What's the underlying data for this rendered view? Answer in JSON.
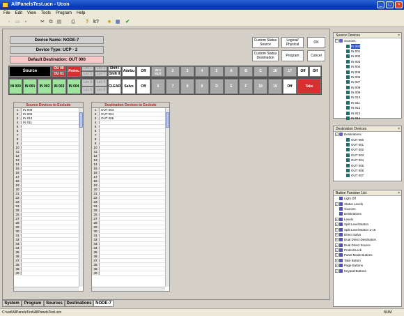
{
  "window": {
    "title": "AllPanelsTest.ucn - Ucon",
    "minimize": "_",
    "maximize": "□",
    "close": "×"
  },
  "menu": [
    "File",
    "Edit",
    "View",
    "Tools",
    "Program",
    "Help"
  ],
  "toolbar_icons": [
    "new-icon",
    "open-icon",
    "save-icon",
    "cut-icon",
    "copy-icon",
    "paste-icon",
    "print-icon",
    "help-icon",
    "context-help-icon",
    "folder-icon",
    "panel-icon",
    "check-icon"
  ],
  "device": {
    "name": "Device Name: NODE-7",
    "type": "Device Type: UCP - 2",
    "default_dest": "Default Destination: OUT 000"
  },
  "buttons": {
    "custom_src": "Custom Status Source",
    "logical": "Logical/ Physical",
    "ok": "OK",
    "custom_dest": "Custom Status Destination",
    "program": "Program",
    "cancel": "Cancel"
  },
  "keys_row1": [
    "Source",
    "OU 00",
    "OU 01",
    "Protec",
    "Lev 1",
    "Lev 3",
    "Shift I",
    "Attribu",
    "Off",
    "IN 1 OUT",
    "2",
    "3",
    "4",
    "5",
    "A",
    "B",
    "C",
    "16",
    "17",
    "Off",
    "Off"
  ],
  "keys_lev": [
    "Lev 1",
    "Lev 3",
    "Lev 5",
    "Lev 7",
    "Lev 2",
    "Lev 4",
    "Lev 6",
    "Lev 8"
  ],
  "keys_shift": [
    "Shift I",
    "Shift II"
  ],
  "keys_row2": [
    "IN 000",
    "IN 001",
    "IN 002",
    "IN 003",
    "IN 004",
    "CLEAR",
    "Salvo",
    "Off",
    "6",
    "7",
    "8",
    "9",
    "D",
    "E",
    "F",
    "18",
    "19",
    "Off",
    "Take"
  ],
  "src_exclude": {
    "title": "Source Devices to Exclude",
    "rows": [
      "IN 008",
      "IN 009",
      "IN 010",
      "IN 011",
      "",
      "",
      "",
      "",
      "",
      "",
      "",
      "",
      "",
      "",
      "",
      "",
      "",
      "",
      "",
      "",
      "",
      "",
      "",
      "",
      "",
      "",
      "",
      "",
      "",
      "",
      "",
      "",
      "",
      "",
      "",
      "",
      "",
      "",
      "",
      ""
    ]
  },
  "dst_exclude": {
    "title": "Destination Devices to Exclude",
    "rows": [
      "OUT 003",
      "OUT 004",
      "OUT 005",
      "",
      "",
      "",
      "",
      "",
      "",
      "",
      "",
      "",
      "",
      "",
      "",
      "",
      "",
      "",
      "",
      "",
      "",
      "",
      "",
      "",
      "",
      "",
      "",
      "",
      "",
      "",
      "",
      "",
      "",
      "",
      "",
      "",
      "",
      "",
      "",
      ""
    ]
  },
  "tabs": [
    "System",
    "Program",
    "Sources",
    "Destinations",
    "NODE-7"
  ],
  "status": {
    "path": "C:\\ust\\AllPanelsTest\\AllPanelsTest.ucn",
    "num": "NUM"
  },
  "source_devices": {
    "title": "Source Devices",
    "root": "Sources",
    "items": [
      "IN 000",
      "IN 001",
      "IN 002",
      "IN 003",
      "IN 004",
      "IN 005",
      "IN 006",
      "IN 007",
      "IN 008",
      "IN 009",
      "IN 010",
      "IN 011",
      "IN 012",
      "IN 013",
      "IN 014"
    ]
  },
  "destination_devices": {
    "title": "Destination Devices",
    "root": "Destinations",
    "items": [
      "OUT 000",
      "OUT 001",
      "OUT 002",
      "OUT 003",
      "OUT 004",
      "OUT 005",
      "OUT 006",
      "OUT 007"
    ]
  },
  "button_functions": {
    "title": "Button Function List",
    "items": [
      "Light Off",
      "Status Levels",
      "Sources",
      "Destinations",
      "Levels",
      "Split Level Button",
      "Split Level Button 1-16",
      "Direct Salvo",
      "Dual Direct Destination",
      "Dual Direct Source",
      "Protect/Lock",
      "Panel Mode Buttons",
      "Take Button",
      "Page Buttons",
      "Keypad Buttons"
    ]
  }
}
